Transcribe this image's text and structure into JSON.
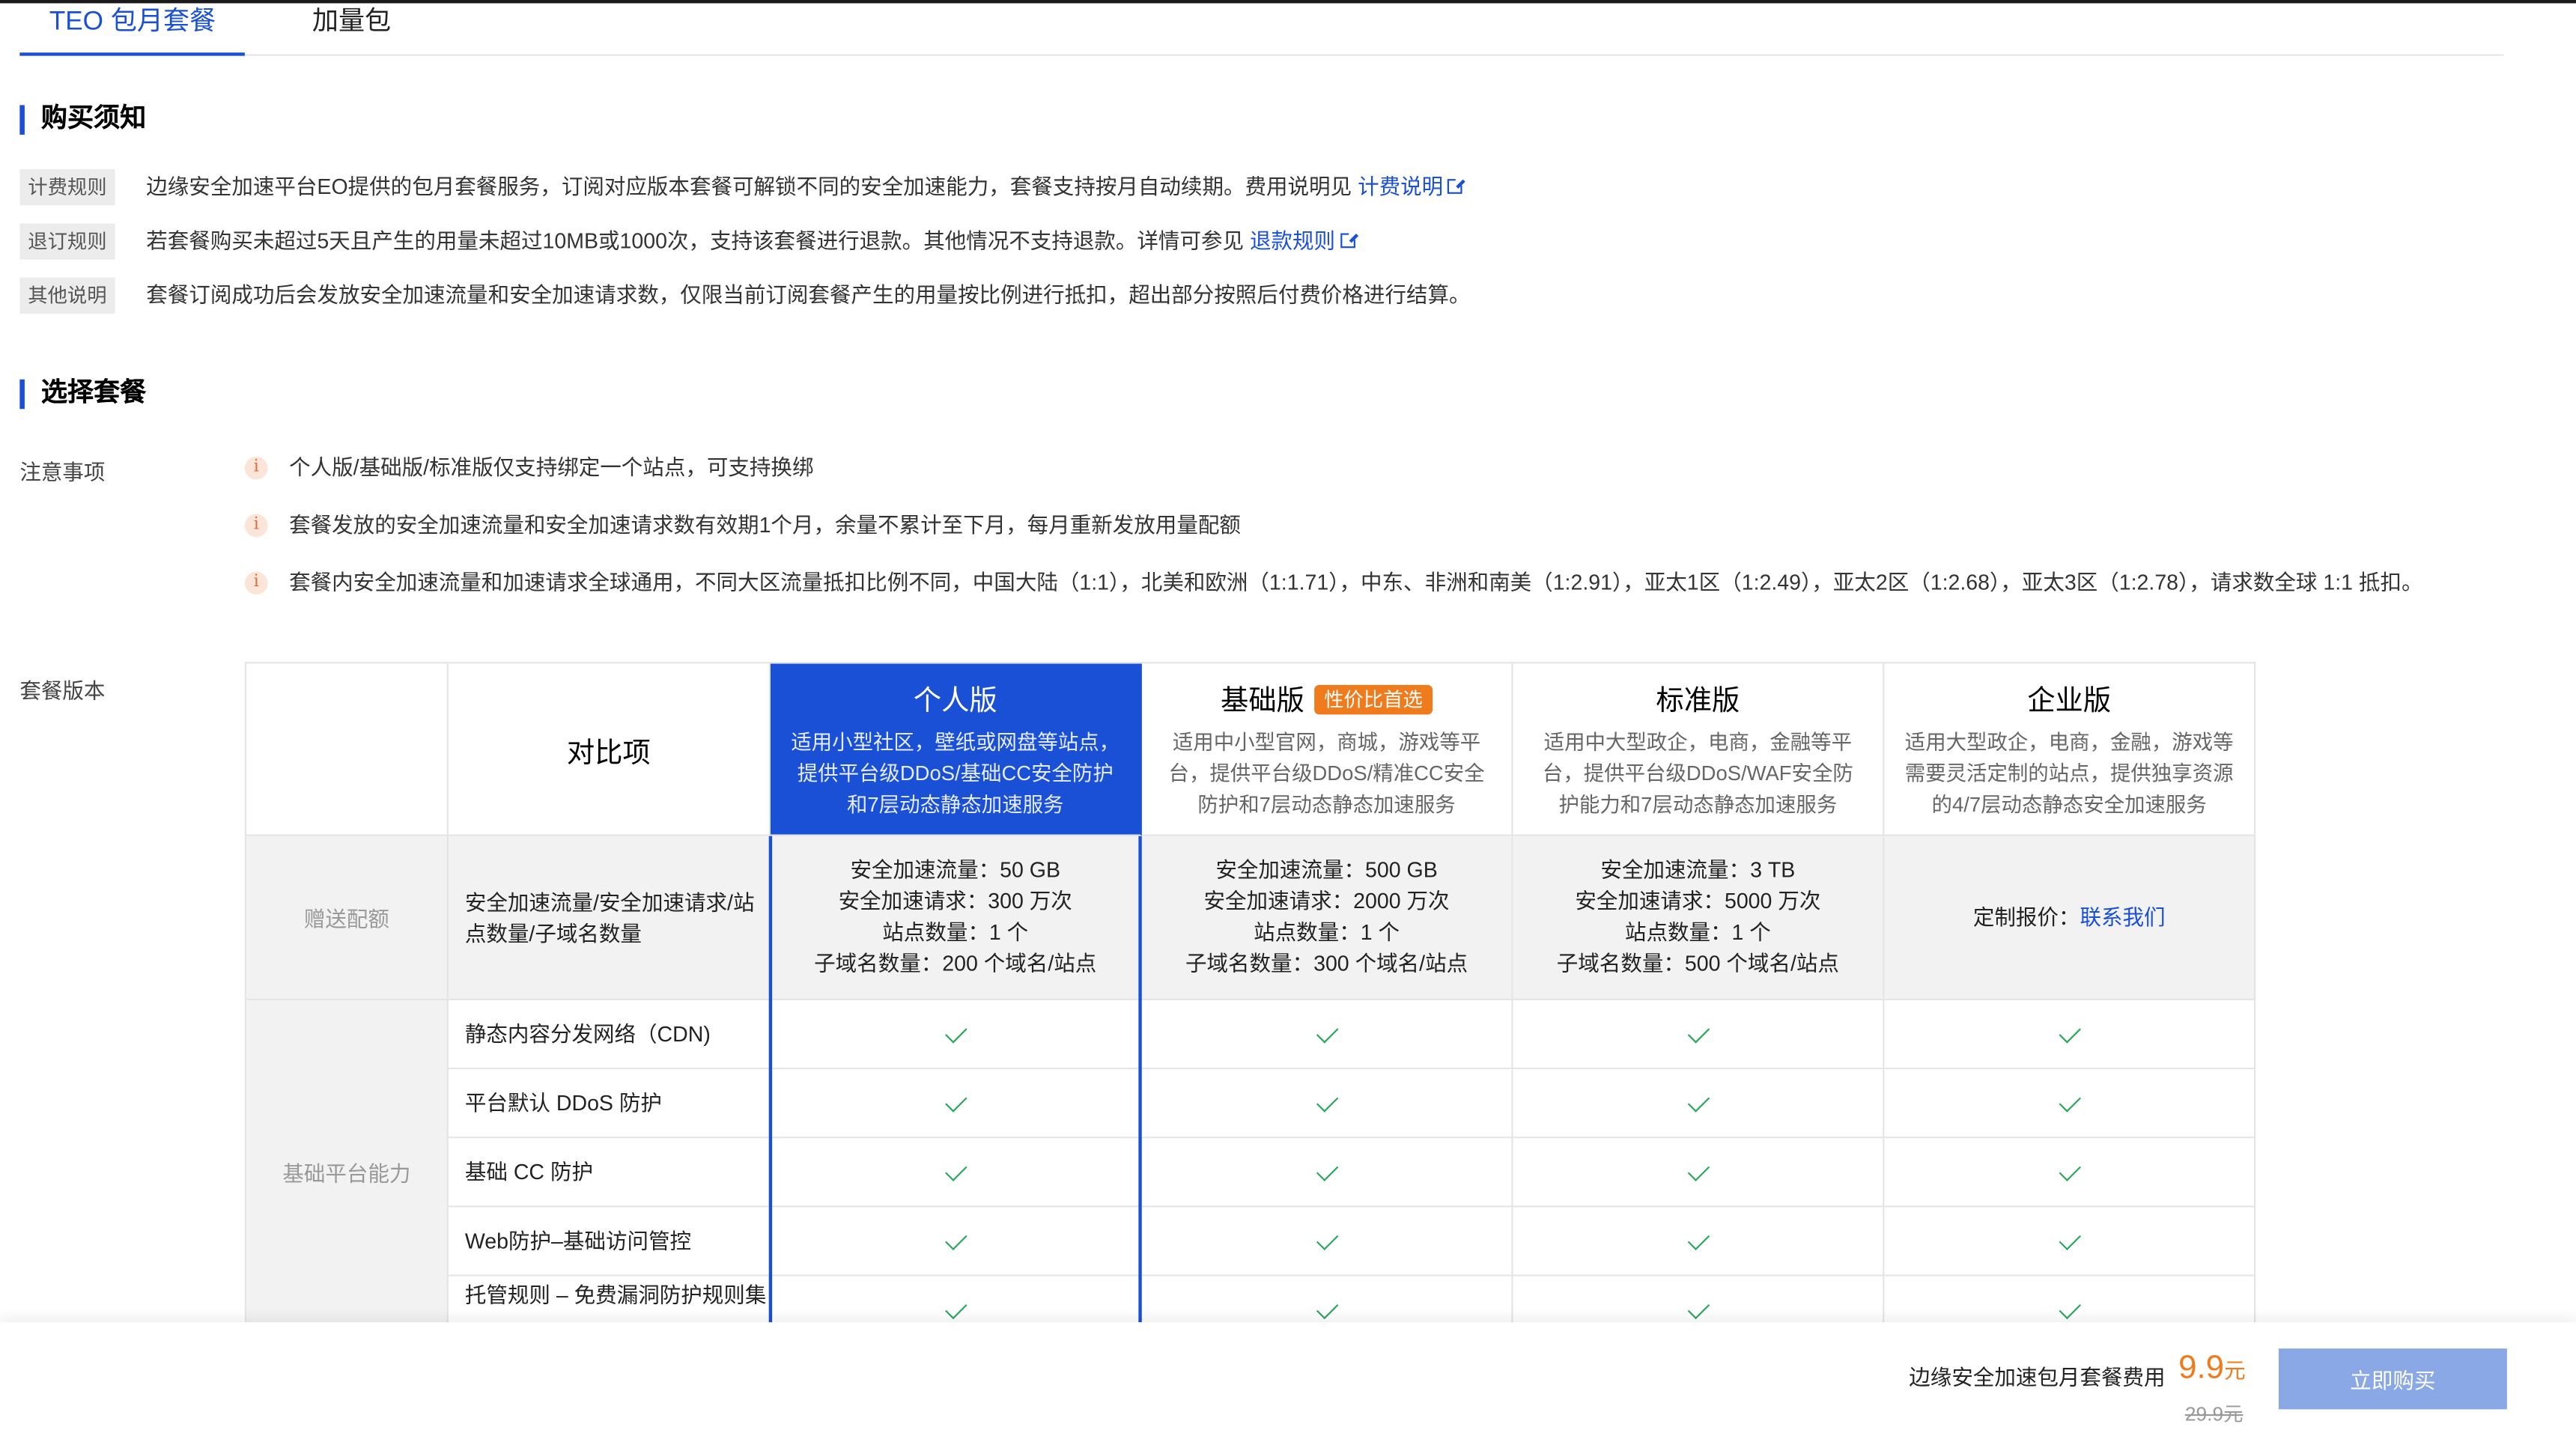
{
  "tabs": [
    {
      "label": "TEO 包月套餐",
      "active": true
    },
    {
      "label": "加量包",
      "active": false
    }
  ],
  "purchase_notice": {
    "title": "购买须知",
    "rows": [
      {
        "label": "计费规则",
        "text": "边缘安全加速平台EO提供的包月套餐服务，订阅对应版本套餐可解锁不同的安全加速能力，套餐支持按月自动续期。费用说明见",
        "link": "计费说明"
      },
      {
        "label": "退订规则",
        "text": "若套餐购买未超过5天且产生的用量未超过10MB或1000次，支持该套餐进行退款。其他情况不支持退款。详情可参见",
        "link": "退款规则"
      },
      {
        "label": "其他说明",
        "text": "套餐订阅成功后会发放安全加速流量和安全加速请求数，仅限当前订阅套餐产生的用量按比例进行抵扣，超出部分按照后付费价格进行结算。",
        "link": ""
      }
    ]
  },
  "choose_plan": {
    "title": "选择套餐",
    "notes_label": "注意事项",
    "notes": [
      "个人版/基础版/标准版仅支持绑定一个站点，可支持换绑",
      "套餐发放的安全加速流量和安全加速请求数有效期1个月，余量不累计至下月，每月重新发放用量配额",
      "套餐内安全加速流量和加速请求全球通用，不同大区流量抵扣比例不同，中国大陆（1:1），北美和欧洲（1:1.71），中东、非洲和南美（1:2.91），亚太1区（1:2.49），亚太2区（1:2.68），亚太3区（1:2.78），请求数全球 1:1 抵扣。"
    ],
    "version_label": "套餐版本"
  },
  "table": {
    "compare_header": "对比项",
    "plans": [
      {
        "name": "个人版",
        "badge": "",
        "desc": "适用小型社区，壁纸或网盘等站点，提供平台级DDoS/基础CC安全防护和7层动态静态加速服务",
        "selected": true
      },
      {
        "name": "基础版",
        "badge": "性价比首选",
        "desc": "适用中小型官网，商城，游戏等平台，提供平台级DDoS/精准CC安全防护和7层动态静态加速服务",
        "selected": false
      },
      {
        "name": "标准版",
        "badge": "",
        "desc": "适用中大型政企，电商，金融等平台，提供平台级DDoS/WAF安全防护能力和7层动态静态加速服务",
        "selected": false
      },
      {
        "name": "企业版",
        "badge": "",
        "desc": "适用大型政企，电商，金融，游戏等需要灵活定制的站点，提供独享资源的4/7层动态静态安全加速服务",
        "selected": false
      }
    ],
    "gift": {
      "group": "赠送配额",
      "head": "安全加速流量/安全加速请求/站点数量/子域名数量",
      "values": [
        [
          "安全加速流量：50 GB",
          "安全加速请求：300 万次",
          "站点数量：1 个",
          "子域名数量：200 个域名/站点"
        ],
        [
          "安全加速流量：500 GB",
          "安全加速请求：2000 万次",
          "站点数量：1 个",
          "子域名数量：300 个域名/站点"
        ],
        [
          "安全加速流量：3 TB",
          "安全加速请求：5000 万次",
          "站点数量：1 个",
          "子域名数量：500 个域名/站点"
        ]
      ],
      "enterprise_text": "定制报价：",
      "enterprise_link": "联系我们"
    },
    "base_group": "基础平台能力",
    "features": [
      "静态内容分发网络（CDN)",
      "平台默认 DDoS 防护",
      "基础 CC 防护",
      "Web防护–基础访问管控",
      "托管规则 – 免费漏洞防护规则集"
    ],
    "check_icon": "check-icon",
    "colors": {
      "accent": "#1a50d6",
      "badge": "#ef7b1d",
      "check": "#29a85b"
    }
  },
  "footer": {
    "fee_label": "边缘安全加速包月套餐费用",
    "price": "9.9",
    "unit": "元",
    "old_price": "29.9元",
    "buy_label": "立即购买"
  }
}
